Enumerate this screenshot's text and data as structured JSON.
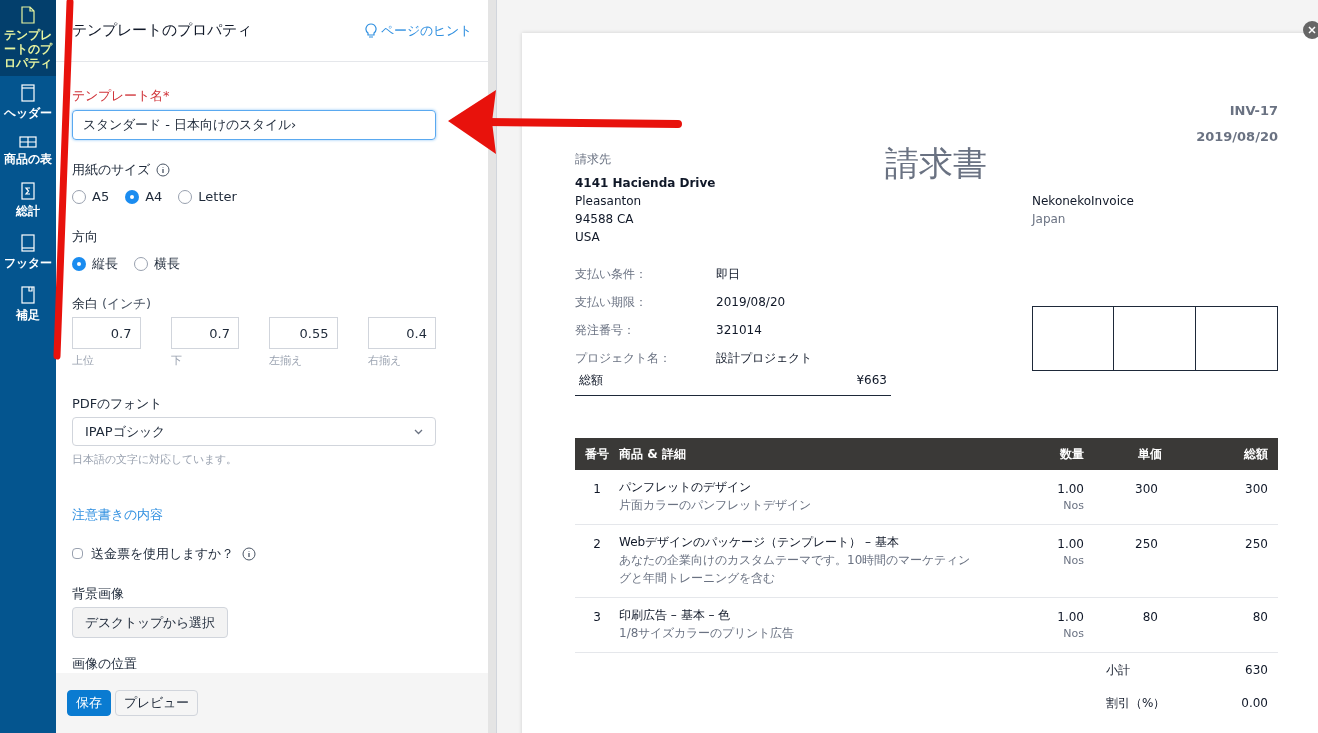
{
  "sidebar": {
    "items": [
      {
        "label": "テンプレートのプロパティ",
        "kind": "page",
        "selected": true
      },
      {
        "label": "ヘッダー",
        "kind": "header",
        "selected": false
      },
      {
        "label": "商品の表",
        "kind": "table",
        "selected": false
      },
      {
        "label": "総計",
        "kind": "sigma",
        "selected": false
      },
      {
        "label": "フッター",
        "kind": "footer",
        "selected": false
      },
      {
        "label": "補足",
        "kind": "note",
        "selected": false
      }
    ]
  },
  "panel": {
    "title": "テンプレートのプロパティ",
    "hint_link": "ページのヒント",
    "template_name": {
      "label": "テンプレート名",
      "required_mark": "*",
      "value": "スタンダード - 日本向けのスタイル›"
    },
    "paper_size": {
      "label": "用紙のサイズ",
      "options": [
        {
          "label": "A5",
          "selected": false
        },
        {
          "label": "A4",
          "selected": true
        },
        {
          "label": "Letter",
          "selected": false
        }
      ]
    },
    "orientation": {
      "label": "方向",
      "options": [
        {
          "label": "縦長",
          "selected": true
        },
        {
          "label": "横長",
          "selected": false
        }
      ]
    },
    "margins": {
      "label": "余白",
      "unit": "(インチ)",
      "fields": [
        {
          "value": "0.7",
          "caption": "上位"
        },
        {
          "value": "0.7",
          "caption": "下"
        },
        {
          "value": "0.55",
          "caption": "左揃え"
        },
        {
          "value": "0.4",
          "caption": "右揃え"
        }
      ]
    },
    "pdf_font": {
      "label": "PDFのフォント",
      "value": "IPAPゴシック",
      "help": "日本語の文字に対応しています。"
    },
    "notes_link": "注意書きの内容",
    "remittance": {
      "label": "送金票を使用しますか？",
      "checked": false
    },
    "background": {
      "label": "背景画像",
      "button": "デスクトップから選択"
    },
    "image_position": {
      "label": "画像の位置"
    }
  },
  "footer_buttons": [
    {
      "label": "保存",
      "kind": "primary"
    },
    {
      "label": "プレビュー",
      "kind": "secondary"
    }
  ],
  "invoice": {
    "number": "INV-17",
    "date": "2019/08/20",
    "title": "請求書",
    "bill_to": {
      "label": "請求先",
      "lines": [
        "4141 Hacienda Drive",
        "Pleasanton",
        "94588 CA",
        "USA"
      ]
    },
    "company": {
      "name": "NekonekoInvoice",
      "country": "Japan"
    },
    "details": [
      {
        "label": "支払い条件：",
        "value": "即日"
      },
      {
        "label": "支払い期限：",
        "value": "2019/08/20"
      },
      {
        "label": "発注番号：",
        "value": "321014"
      },
      {
        "label": "プロジェクト名：",
        "value": "設計プロジェクト"
      }
    ],
    "total": {
      "label": "総額",
      "value": "¥663"
    },
    "table": {
      "columns": [
        "番号",
        "商品 & 詳細",
        "数量",
        "単価",
        "総額"
      ],
      "rows": [
        {
          "no": "1",
          "name": "パンフレットのデザイン",
          "desc": "片面カラーのパンフレットデザイン",
          "qty": "1.00",
          "unit": "Nos",
          "price": "300",
          "amount": "300"
        },
        {
          "no": "2",
          "name": "Webデザインのパッケージ（テンプレート） – 基本",
          "desc": "あなたの企業向けのカスタムテーマです。10時間のマーケティングと年間トレーニングを含む",
          "qty": "1.00",
          "unit": "Nos",
          "price": "250",
          "amount": "250"
        },
        {
          "no": "3",
          "name": "印刷広告 – 基本 – 色",
          "desc": "1/8サイズカラーのプリント広告",
          "qty": "1.00",
          "unit": "Nos",
          "price": "80",
          "amount": "80"
        }
      ]
    },
    "summary": [
      {
        "label": "小計",
        "value": "630"
      },
      {
        "label": "割引（%）",
        "value": "0.00"
      }
    ]
  }
}
